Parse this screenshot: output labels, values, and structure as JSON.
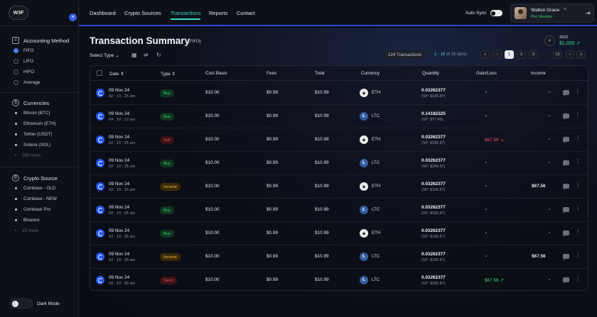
{
  "brand": {
    "logo": "W3F"
  },
  "nav": {
    "items": [
      {
        "label": "Dashboard",
        "active": false
      },
      {
        "label": "Crypto Sources",
        "active": false
      },
      {
        "label": "Transactions",
        "active": true
      },
      {
        "label": "Reports",
        "active": false
      },
      {
        "label": "Contact",
        "active": false
      }
    ],
    "auto_sync_label": "Auto Sync",
    "auto_sync_on": false
  },
  "user": {
    "name": "Walton Grace",
    "role": "Pro Version"
  },
  "sidebar": {
    "accounting": {
      "title": "Accounting Method",
      "items": [
        {
          "label": "FIFO",
          "selected": true
        },
        {
          "label": "LIFO",
          "selected": false
        },
        {
          "label": "HIFO",
          "selected": false
        },
        {
          "label": "Average",
          "selected": false
        }
      ]
    },
    "currencies": {
      "title": "Currencies",
      "items": [
        "Bitcoin (BTC)",
        "Ethereum (ETH)",
        "Tether (USDT)",
        "Solana (SOL)"
      ],
      "more": "180 more"
    },
    "sources": {
      "title": "Crypto Source",
      "items": [
        "Coinbase - OLD",
        "Coinbase - NEW",
        "Coinbase Pro",
        "Binance"
      ],
      "more": "15 more"
    },
    "dark_mode_label": "Dark Mode"
  },
  "main": {
    "title": "Transaction Summary",
    "method": "(FIFO)",
    "select_type": "Select Type",
    "summary_year": "2022",
    "summary_value": "$1,055",
    "total_count": "224 Transactions",
    "range_current": "1 - 16",
    "range_total": "of 16 items",
    "pages": [
      "1",
      "2",
      "3",
      "...",
      "10"
    ]
  },
  "table": {
    "headers": {
      "date": "Date",
      "type": "Type",
      "cost_basis": "Cost Basis",
      "fees": "Fees",
      "total": "Total",
      "currency": "Currency",
      "quantity": "Quantity",
      "gain_loss": "Gain/Loss",
      "income": "Income"
    },
    "rows": [
      {
        "date": "09 Nov 24",
        "time": "02 : 10 : 25 am",
        "type": "Buy",
        "cost": "$10.00",
        "fees": "$0.99",
        "total": "$10.99",
        "currency": "ETH",
        "qty": "0.03262377",
        "sp": "(SP: $336.87)",
        "gain": "-",
        "income": "-"
      },
      {
        "date": "09 Nov 24",
        "time": "04 : 10 : 12 am",
        "type": "Buy",
        "cost": "$10.00",
        "fees": "$0.99",
        "total": "$10.99",
        "currency": "LTC",
        "qty": "0.14182225",
        "sp": "(SP: $77.49)",
        "gain": "-",
        "income": "-"
      },
      {
        "date": "09 Nov 24",
        "time": "02 : 10 : 25 am",
        "type": "Sell",
        "cost": "$10.00",
        "fees": "$0.99",
        "total": "$10.99",
        "currency": "ETH",
        "qty": "0.03262377",
        "sp": "(SP: $336.87)",
        "gain": "$67.56",
        "gain_dir": "neg",
        "income": "-"
      },
      {
        "date": "09 Nov 24",
        "time": "02 : 10 : 25 am",
        "type": "Buy",
        "cost": "$10.00",
        "fees": "$0.99",
        "total": "$10.99",
        "currency": "LTC",
        "qty": "0.03262377",
        "sp": "(SP: $336.87)",
        "gain": "-",
        "income": "-"
      },
      {
        "date": "09 Nov 24",
        "time": "02 : 10 : 25 am",
        "type": "Income",
        "cost": "$10.00",
        "fees": "$0.99",
        "total": "$10.99",
        "currency": "ETH",
        "qty": "0.03262377",
        "sp": "(SP: $336.87)",
        "gain": "-",
        "income": "$67.56"
      },
      {
        "date": "09 Nov 24",
        "time": "02 : 10 : 25 am",
        "type": "Buy",
        "cost": "$10.00",
        "fees": "$0.99",
        "total": "$10.99",
        "currency": "LTC",
        "qty": "0.03262377",
        "sp": "(SP: $336.87)",
        "gain": "-",
        "income": "-"
      },
      {
        "date": "09 Nov 24",
        "time": "02 : 10 : 25 am",
        "type": "Buy",
        "cost": "$10.00",
        "fees": "$0.99",
        "total": "$10.99",
        "currency": "ETH",
        "qty": "0.03262377",
        "sp": "(SP: $336.87)",
        "gain": "-",
        "income": "-"
      },
      {
        "date": "09 Nov 24",
        "time": "02 : 10 : 25 am",
        "type": "Income",
        "cost": "$10.00",
        "fees": "$0.99",
        "total": "$10.99",
        "currency": "LTC",
        "qty": "0.03262377",
        "sp": "(SP: $336.87)",
        "gain": "-",
        "income": "$67.56"
      },
      {
        "date": "09 Nov 24",
        "time": "02 : 10 : 25 am",
        "type": "Send",
        "cost": "$10.00",
        "fees": "$0.99",
        "total": "$10.99",
        "currency": "LTC",
        "qty": "0.03262377",
        "sp": "(SP: $336.87)",
        "gain": "$67.56",
        "gain_dir": "pos",
        "income": "-"
      }
    ]
  },
  "colors": {
    "accent": "#38d4c0",
    "positive": "#37d67a",
    "negative": "#f0516a",
    "income": "#f2b339",
    "brand_blue": "#2b4bd8"
  }
}
